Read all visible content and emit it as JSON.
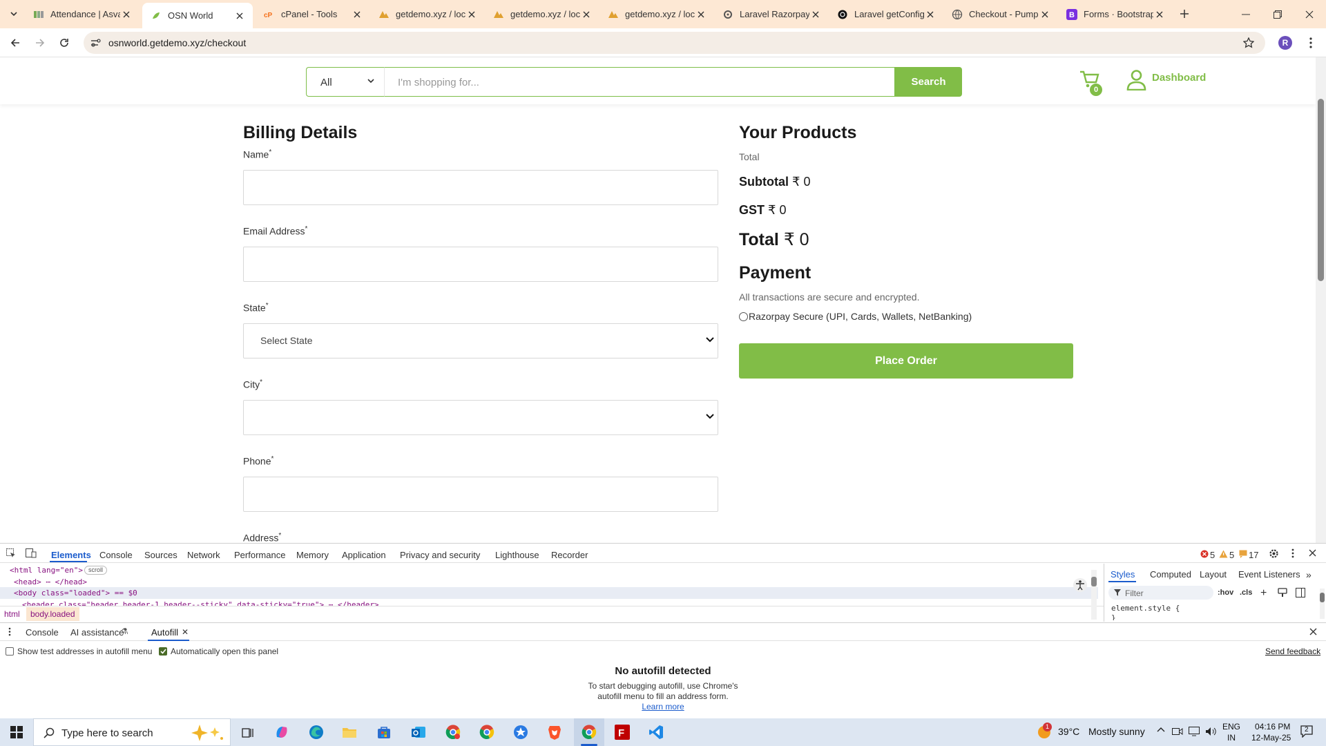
{
  "browser": {
    "tabs": [
      {
        "title": "Attendance | Asva",
        "icon": "attendance-icon"
      },
      {
        "title": "OSN World",
        "icon": "osn-icon",
        "active": true
      },
      {
        "title": "cPanel - Tools",
        "icon": "cpanel-icon"
      },
      {
        "title": "getdemo.xyz / loc",
        "icon": "phpmyadmin-icon"
      },
      {
        "title": "getdemo.xyz / loc",
        "icon": "phpmyadmin-icon"
      },
      {
        "title": "getdemo.xyz / loc",
        "icon": "phpmyadmin-icon"
      },
      {
        "title": "Laravel Razorpay",
        "icon": "gear-icon"
      },
      {
        "title": "Laravel getConfig",
        "icon": "openai-icon"
      },
      {
        "title": "Checkout - Pump",
        "icon": "globe-icon"
      },
      {
        "title": "Forms · Bootstrap",
        "icon": "bootstrap-icon"
      }
    ],
    "url": "osnworld.getdemo.xyz/checkout",
    "profile_initial": "R"
  },
  "header": {
    "category": "All",
    "search_placeholder": "I'm shopping for...",
    "search_button": "Search",
    "cart_count": "0",
    "dashboard": "Dashboard"
  },
  "billing": {
    "title": "Billing Details",
    "fields": [
      {
        "label": "Name",
        "required": "*",
        "value": ""
      },
      {
        "label": "Email Address",
        "required": "*",
        "value": ""
      },
      {
        "label": "State",
        "required": "*",
        "value": "Select State"
      },
      {
        "label": "City",
        "required": "*",
        "value": ""
      },
      {
        "label": "Phone",
        "required": "*",
        "value": ""
      },
      {
        "label": "Address",
        "required": "*"
      }
    ]
  },
  "products": {
    "title": "Your Products",
    "total_label": "Total",
    "subtotal_label": "Subtotal",
    "subtotal_value": "₹ 0",
    "gst_label": "GST",
    "gst_value": "₹ 0",
    "grand_label": "Total",
    "grand_value": "₹ 0",
    "payment_title": "Payment",
    "secure_text": "All transactions are secure and encrypted.",
    "razorpay_option": "Razorpay Secure (UPI, Cards, Wallets, NetBanking)",
    "place_order": "Place Order"
  },
  "devtools": {
    "tabs": [
      "Elements",
      "Console",
      "Sources",
      "Network",
      "Performance",
      "Memory",
      "Application",
      "Privacy and security",
      "Lighthouse",
      "Recorder"
    ],
    "errors": "5",
    "warnings": "5",
    "messages": "17",
    "dom_lines": [
      "<html lang=\"en\">",
      "<head> ⋯ </head>",
      "<body class=\"loaded\"> == $0",
      "<header class=\"header header-1 header--sticky\" data-sticky=\"true\"> ⋯ </header>"
    ],
    "scroll_badge": "scroll",
    "breadcrumb": [
      "html",
      "body.loaded"
    ],
    "styles_tabs": [
      "Styles",
      "Computed",
      "Layout",
      "Event Listeners"
    ],
    "filter_placeholder": "Filter",
    "hov": ":hov",
    "cls": ".cls",
    "element_style": "element.style {",
    "element_style_close": "}",
    "drawer_tabs": [
      "Console",
      "AI assistance",
      "Autofill"
    ],
    "show_test_addresses": "Show test addresses in autofill menu",
    "auto_open": "Automatically open this panel",
    "send_feedback": "Send feedback",
    "no_autofill": "No autofill detected",
    "autofill_hint_1": "To start debugging autofill, use Chrome's",
    "autofill_hint_2": "autofill menu to fill an address form.",
    "learn_more": "Learn more"
  },
  "taskbar": {
    "search_placeholder": "Type here to search",
    "weather_temp": "39°C",
    "weather_text": "Mostly sunny",
    "weather_badge": "1",
    "lang_1": "ENG",
    "lang_2": "IN",
    "time": "04:16 PM",
    "date": "12-May-25",
    "notifications": "2"
  },
  "colors": {
    "accent": "#81bd47",
    "tabstrip": "#fde8d4",
    "taskbar": "#dde6f2"
  }
}
